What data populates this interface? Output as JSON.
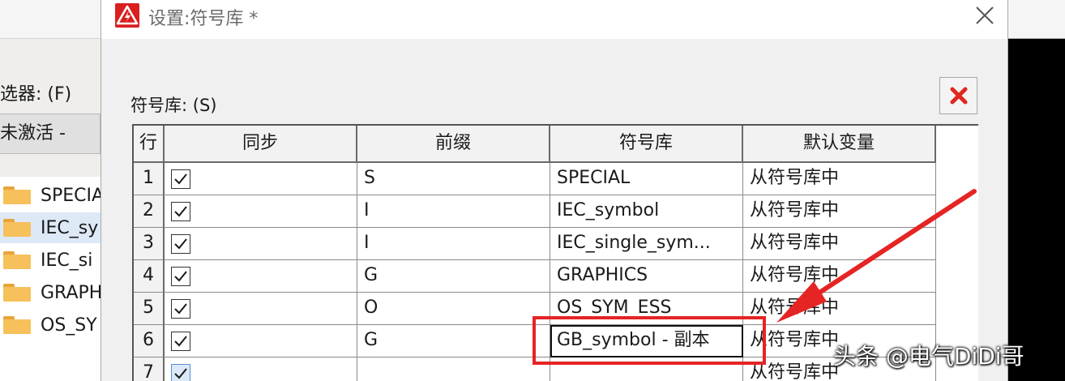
{
  "left_panel": {
    "filter_label": "选器: (F)",
    "state_value": "未激活 -",
    "tree_items": [
      "SPECIA",
      "IEC_sy",
      "IEC_si",
      "GRAPH",
      "OS_SY"
    ]
  },
  "dialog": {
    "title": "设置:符号库 *",
    "lib_label": "符号库: (S)",
    "columns": [
      "行",
      "同步",
      "前缀",
      "符号库",
      "默认变量"
    ],
    "rows": [
      {
        "num": "1",
        "sync": true,
        "prefix": "S",
        "library": "SPECIAL",
        "default": "从符号库中"
      },
      {
        "num": "2",
        "sync": true,
        "prefix": "I",
        "library": "IEC_symbol",
        "default": "从符号库中"
      },
      {
        "num": "3",
        "sync": true,
        "prefix": "I",
        "library": "IEC_single_sym...",
        "default": "从符号库中"
      },
      {
        "num": "4",
        "sync": true,
        "prefix": "G",
        "library": "GRAPHICS",
        "default": "从符号库中"
      },
      {
        "num": "5",
        "sync": true,
        "prefix": "O",
        "library": "OS_SYM_ESS",
        "default": "从符号库中"
      },
      {
        "num": "6",
        "sync": true,
        "prefix": "G",
        "library": "GB_symbol - 副本",
        "default": "从符号库中"
      },
      {
        "num": "7",
        "sync": true,
        "prefix": "",
        "library": "",
        "default": "从符号库中"
      }
    ]
  },
  "watermark": "头条 @电气DiDi哥",
  "colors": {
    "annotation_red": "#e52424",
    "app_icon_red": "#d91f1f"
  }
}
